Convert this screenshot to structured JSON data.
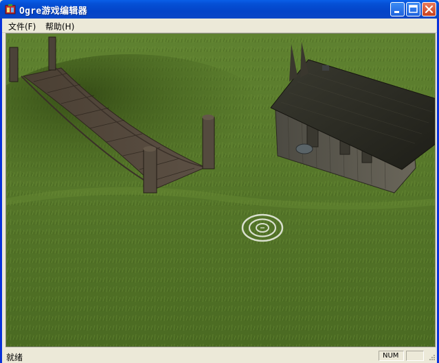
{
  "window": {
    "title": "Ogre游戏编辑器"
  },
  "menu": {
    "items": [
      {
        "label": "文件(F)"
      },
      {
        "label": "帮助(H)"
      }
    ]
  },
  "status": {
    "text": "就绪",
    "num_indicator": "NUM"
  },
  "colors": {
    "titlebar": "#0A5FE8",
    "window_face": "#ECE9D8",
    "close_button": "#C8411F",
    "grass": "#4E6F23"
  },
  "icons": [
    "app-icon",
    "minimize-icon",
    "maximize-icon",
    "close-icon",
    "target-ring-icon",
    "resize-grip-icon"
  ]
}
